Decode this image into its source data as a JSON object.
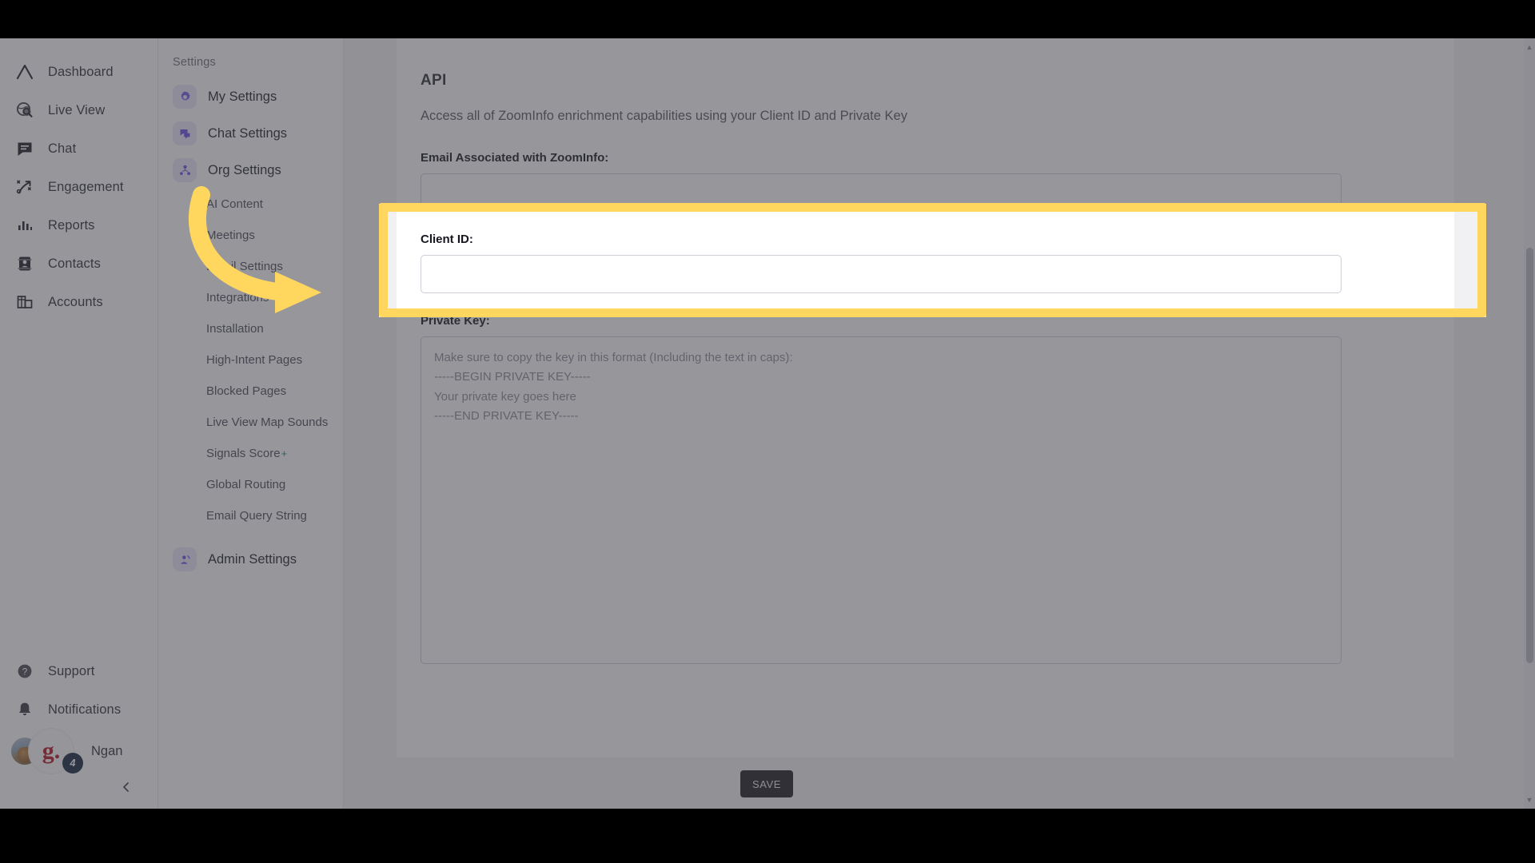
{
  "app": {
    "brand_accent": "#6B4EE6",
    "highlight_color": "#FFD75E",
    "overlay_color": "#424248"
  },
  "icon_rail": {
    "items": [
      {
        "label": "Dashboard",
        "icon": "dashboard-icon"
      },
      {
        "label": "Live View",
        "icon": "live-view-icon"
      },
      {
        "label": "Chat",
        "icon": "chat-icon"
      },
      {
        "label": "Engagement",
        "icon": "engagement-icon"
      },
      {
        "label": "Reports",
        "icon": "reports-icon"
      },
      {
        "label": "Contacts",
        "icon": "contacts-icon"
      },
      {
        "label": "Accounts",
        "icon": "accounts-icon"
      }
    ],
    "bottom_items": [
      {
        "label": "Support",
        "icon": "help-circle-icon"
      },
      {
        "label": "Notifications",
        "icon": "bell-icon"
      }
    ],
    "user": {
      "name": "Ngan",
      "badge_count": "4",
      "avatar_initial": "g."
    },
    "collapse_icon": "chevron-left-icon"
  },
  "settings_nav": {
    "title": "Settings",
    "main_items": [
      {
        "label": "My Settings",
        "icon": "gear-icon"
      },
      {
        "label": "Chat Settings",
        "icon": "chat-bubbles-icon"
      },
      {
        "label": "Org Settings",
        "icon": "org-people-icon"
      }
    ],
    "sub_items": [
      {
        "label": "AI Content"
      },
      {
        "label": "Meetings"
      },
      {
        "label": "Email Settings"
      },
      {
        "label": "Integrations"
      },
      {
        "label": "Installation"
      },
      {
        "label": "High-Intent Pages"
      },
      {
        "label": "Blocked Pages"
      },
      {
        "label": "Live View Map Sounds"
      },
      {
        "label": "Signals Score",
        "superscript": "+"
      },
      {
        "label": "Global Routing"
      },
      {
        "label": "Email Query String"
      }
    ],
    "footer_item": {
      "label": "Admin Settings",
      "icon": "admin-person-icon"
    }
  },
  "main": {
    "heading": "API",
    "description": "Access all of ZoomInfo enrichment capabilities using your Client ID and Private Key",
    "fields": {
      "email": {
        "label": "Email Associated with ZoomInfo:",
        "value": "",
        "placeholder": ""
      },
      "client_id": {
        "label": "Client ID:",
        "value": "",
        "placeholder": ""
      },
      "private_key": {
        "label": "Private Key:",
        "value": "",
        "placeholder": "Make sure to copy the key in this format (Including the text in caps):\n-----BEGIN PRIVATE KEY-----\nYour private key goes here\n-----END PRIVATE KEY-----"
      }
    },
    "save_label": "SAVE"
  }
}
